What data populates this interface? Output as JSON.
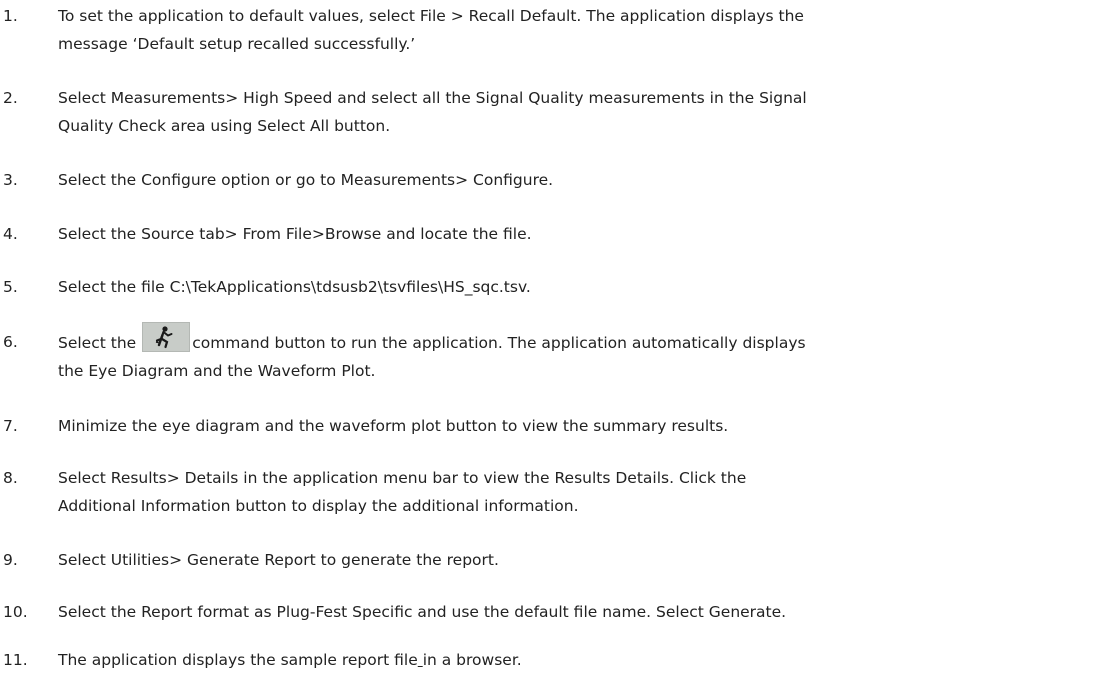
{
  "steps": [
    {
      "num": "1.",
      "line1": "To set the application to default values, select File > Recall Default. The application displays the",
      "line2": "message ‘Default setup recalled successfully.’"
    },
    {
      "num": "2.",
      "line1": "Select Measurements> High Speed and select all the Signal Quality measurements in the Signal",
      "line2": "Quality Check area using Select All button."
    },
    {
      "num": "3.",
      "text": "Select the Configure option or go to Measurements> Configure."
    },
    {
      "num": "4.",
      "text": "Select the Source tab> From File>Browse and locate the file."
    },
    {
      "num": "5.",
      "text": "Select the file C:\\TekApplications\\tdsusb2\\tsvfiles\\HS_sqc.tsv."
    },
    {
      "num": "6.",
      "pre": "Select the",
      "post": "command button to run the application. The application automatically displays",
      "line2": "the Eye Diagram and the Waveform Plot.",
      "icon": "run-icon"
    },
    {
      "num": "7.",
      "text": "Minimize the eye diagram and the waveform plot button to view the summary results."
    },
    {
      "num": "8.",
      "line1": "Select Results> Details in the application menu bar to view the Results Details. Click the",
      "line2": "Additional Information button to display the additional information."
    },
    {
      "num": "9.",
      "text": "Select Utilities> Generate Report to generate the report."
    },
    {
      "num": "10.",
      "text": "Select the Report format as Plug-Fest Specific and use the default file name. Select Generate."
    },
    {
      "num": "11.",
      "pre": "The application displays the sample report file",
      "mid": " ",
      "post": "in a browser."
    }
  ],
  "colors": {
    "text": "#222222",
    "icon_bg": "#c8ccc8"
  }
}
